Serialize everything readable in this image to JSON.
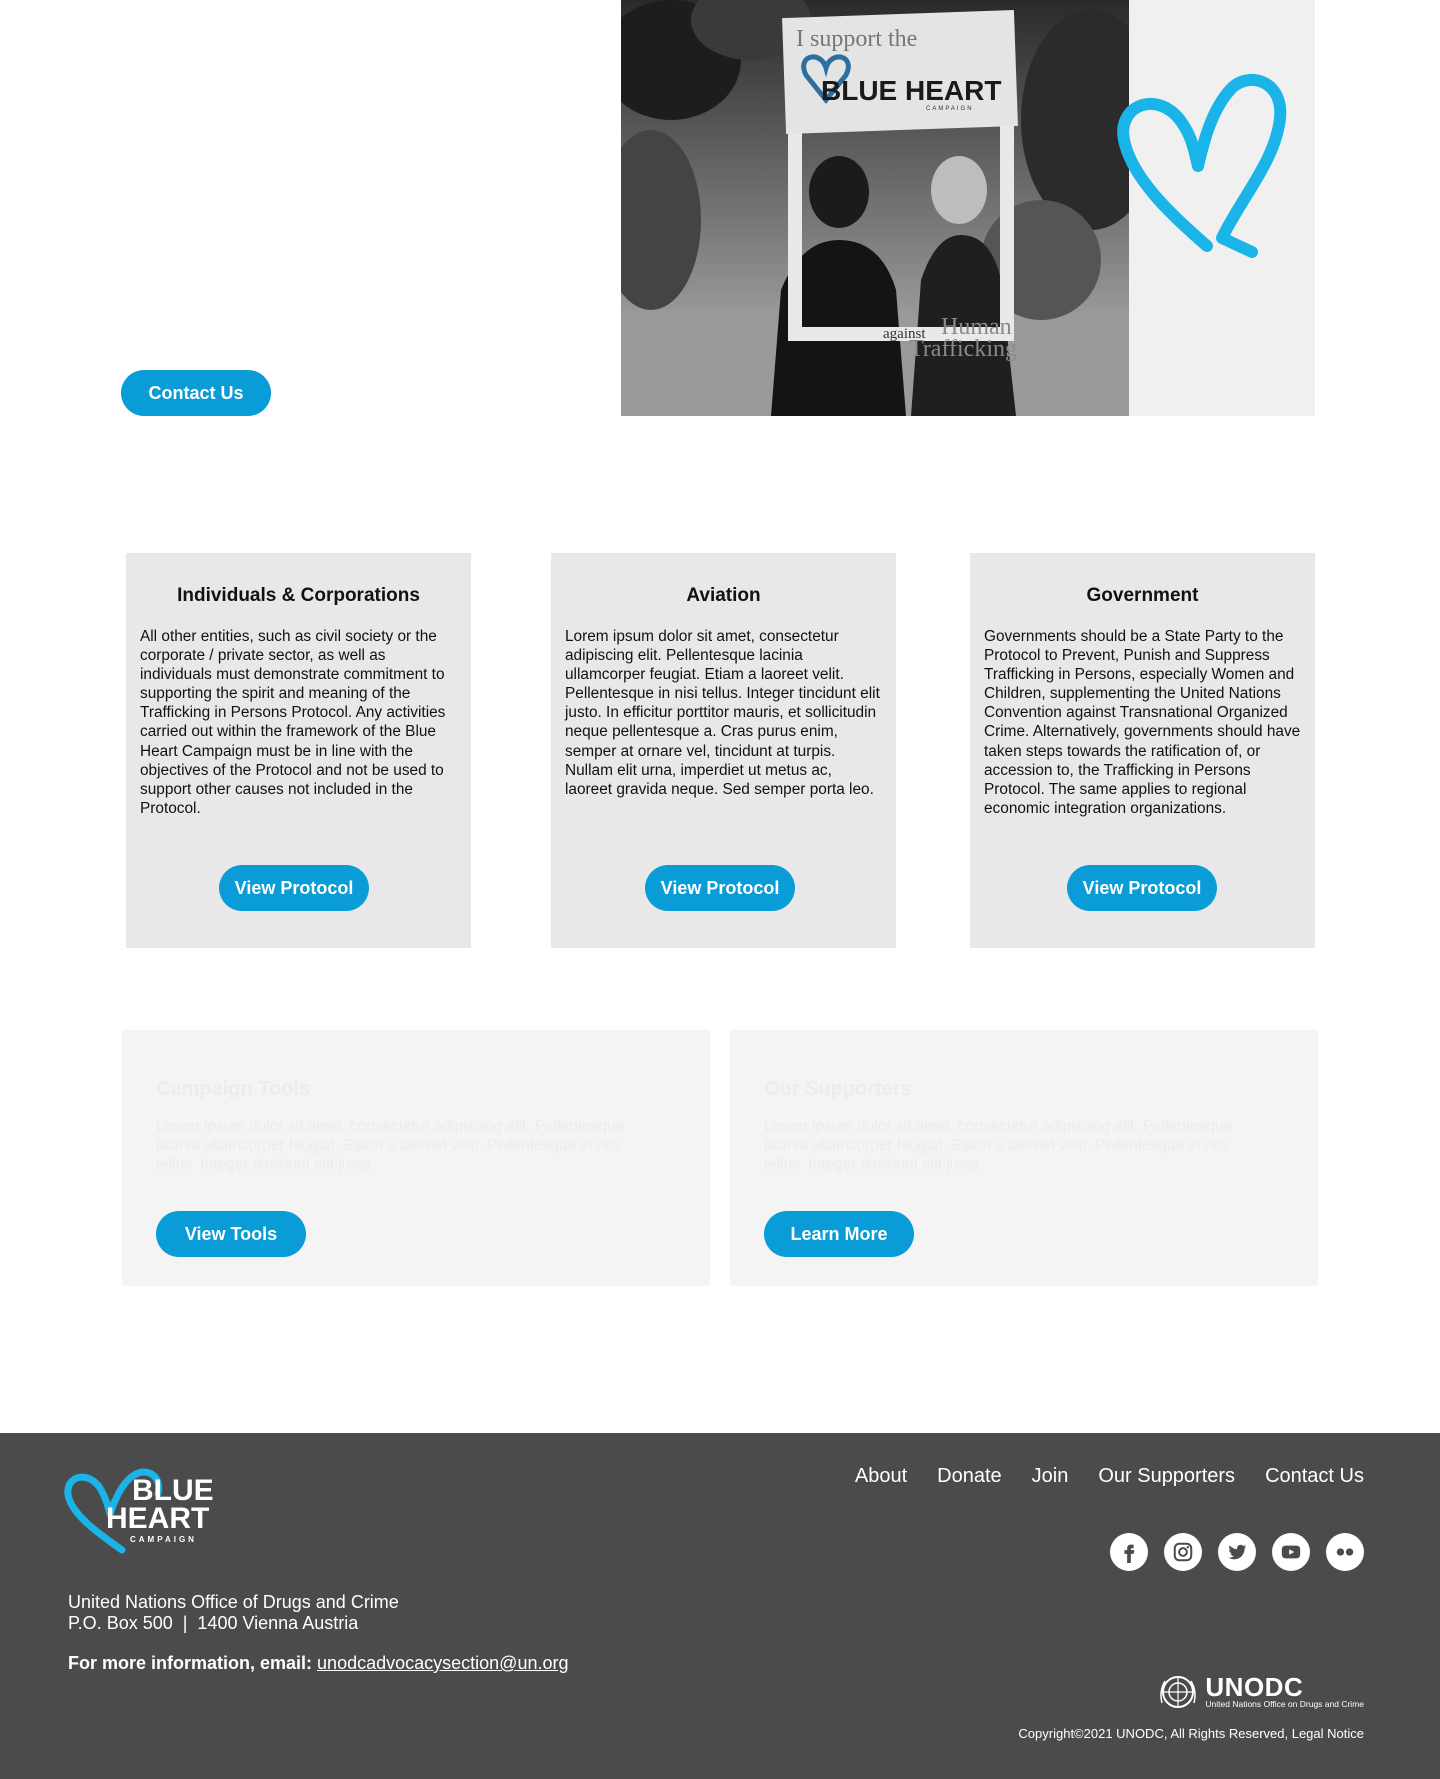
{
  "hero": {
    "contact_label": "Contact Us",
    "image_alt": "I support the Blue Heart Campaign against Human Trafficking",
    "sign": {
      "top_text": "I support the",
      "brand": "BLUE HEART",
      "brand_sub": "CAMPAIGN",
      "bottom_small": "against",
      "bottom_large1": "Human",
      "bottom_large2": "Trafficking"
    },
    "heart_icon": "heart-outline-icon"
  },
  "cards": [
    {
      "title": "Individuals & Corporations",
      "body": "All other entities, such as civil society or the corporate / private sector, as well as individuals must demonstrate commitment to supporting the spirit and meaning of the Trafficking in Persons Protocol. Any activities carried out within the framework of the Blue Heart Campaign must be in line with the objectives of the Protocol and not be used to support other causes not included in the Protocol.",
      "button": "View Protocol"
    },
    {
      "title": "Aviation",
      "body": "Lorem ipsum dolor sit amet, consectetur adipiscing elit. Pellentesque lacinia ullamcorper feugiat. Etiam a laoreet velit. Pellentesque in nisi tellus. Integer tincidunt elit justo. In efficitur porttitor mauris, et sollicitudin neque pellentesque a. Cras purus enim, semper at ornare vel, tincidunt at turpis. Nullam elit urna, imperdiet ut metus ac, laoreet gravida neque. Sed semper porta leo.",
      "button": "View Protocol"
    },
    {
      "title": "Government",
      "body": "Governments should be a State Party to the Protocol to Prevent, Punish and Suppress Trafficking in Persons, especially Women and Children, supplementing the United Nations Convention against Transnational Organized Crime. Alternatively, governments should have taken steps towards the ratification of, or accession to, the Trafficking in Persons Protocol. The same applies to regional economic integration organizations.",
      "button": "View Protocol"
    }
  ],
  "panels": [
    {
      "title": "Campaign Tools",
      "body": "Lorem ipsum dolor sit amet, consectetur adipiscing elit. Pellentesque lacinia ullamcorper feugiat. Etiam a laoreet velit. Pellentesque in nisi tellus. Integer tincidunt elit justo.",
      "button": "View Tools"
    },
    {
      "title": "Our Supporters",
      "body": "Lorem ipsum dolor sit amet, consectetur adipiscing elit. Pellentesque lacinia ullamcorper feugiat. Etiam a laoreet velit. Pellentesque in nisi tellus. Integer tincidunt elit justo.",
      "button": "Learn More"
    }
  ],
  "footer": {
    "logo": {
      "line1": "BLUE",
      "line2": "HEART",
      "line3": "CAMPAIGN"
    },
    "address": {
      "org": "United Nations Office of Drugs and Crime",
      "line2": "P.O. Box 500  |  1400 Vienna Austria"
    },
    "email_label": "For more information, email:",
    "email": "unodcadvocacysection@un.org",
    "nav": [
      "About",
      "Donate",
      "Join",
      "Our Supporters",
      "Contact Us"
    ],
    "social": [
      "facebook-icon",
      "instagram-icon",
      "twitter-icon",
      "youtube-icon",
      "flickr-icon"
    ],
    "unodc": {
      "name": "UNODC",
      "sub": "United Nations Office on Drugs and Crime"
    },
    "copyright": "Copyright©2021 UNODC, All Rights Reserved, Legal Notice"
  },
  "colors": {
    "accent": "#0a9cd6",
    "heart": "#1ab4e8",
    "card_bg": "#e8e8e8",
    "panel_bg": "#f4f4f4",
    "footer_bg": "#4b4b4c"
  }
}
